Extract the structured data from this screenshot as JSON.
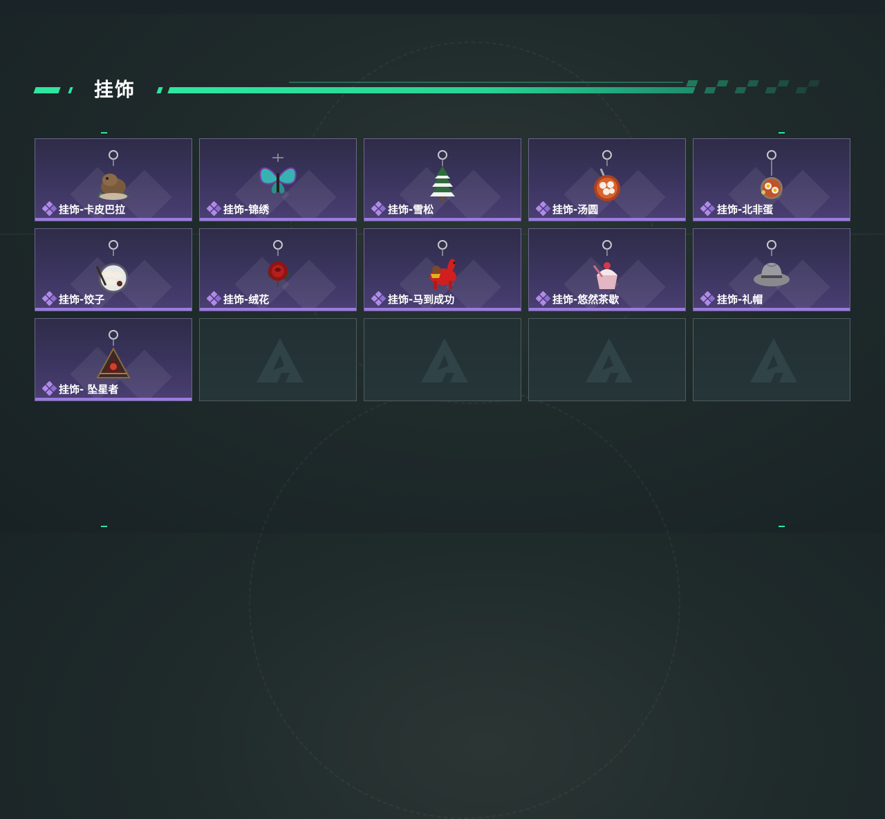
{
  "section": {
    "title": "挂饰"
  },
  "cards": [
    {
      "name": "挂饰-卡皮巴拉",
      "icon": "capybara-charm-icon",
      "filled": true
    },
    {
      "name": "挂饰-锦绣",
      "icon": "butterfly-charm-icon",
      "filled": true
    },
    {
      "name": "挂饰-雪松",
      "icon": "snowy-pine-charm-icon",
      "filled": true
    },
    {
      "name": "挂饰-汤圆",
      "icon": "tangyuan-bowl-charm-icon",
      "filled": true
    },
    {
      "name": "挂饰-北非蛋",
      "icon": "shakshuka-charm-icon",
      "filled": true
    },
    {
      "name": "挂饰-饺子",
      "icon": "dumpling-plate-charm-icon",
      "filled": true
    },
    {
      "name": "挂饰-绒花",
      "icon": "red-rose-charm-icon",
      "filled": true
    },
    {
      "name": "挂饰-马到成功",
      "icon": "red-horse-charm-icon",
      "filled": true
    },
    {
      "name": "挂饰-悠然茶歇",
      "icon": "cupcake-charm-icon",
      "filled": true
    },
    {
      "name": "挂饰-礼帽",
      "icon": "fedora-hat-charm-icon",
      "filled": true
    },
    {
      "name": "挂饰- 坠星者",
      "icon": "triangle-emblem-charm-icon",
      "filled": true
    },
    {
      "name": "",
      "icon": "empty-slot-logo-icon",
      "filled": false
    },
    {
      "name": "",
      "icon": "empty-slot-logo-icon",
      "filled": false
    },
    {
      "name": "",
      "icon": "empty-slot-logo-icon",
      "filled": false
    },
    {
      "name": "",
      "icon": "empty-slot-logo-icon",
      "filled": false
    }
  ],
  "colors": {
    "accent": "#2ee6a0",
    "rarity": "#9b7be0",
    "cardTop": "#2e2c48",
    "cardBottom": "#4a3f72"
  }
}
